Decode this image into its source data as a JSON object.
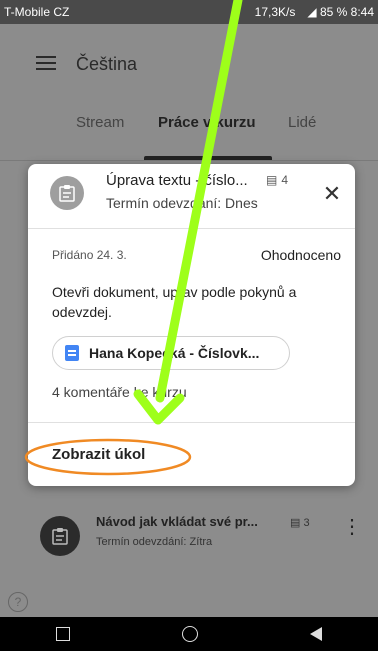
{
  "status_bar": {
    "carrier": "T-Mobile CZ",
    "speed": "17,3K/s",
    "battery": "85 %",
    "time": "8:44"
  },
  "app": {
    "title": "Čeština"
  },
  "tabs": [
    {
      "label": "Stream"
    },
    {
      "label": "Práce v kurzu"
    },
    {
      "label": "Lidé"
    }
  ],
  "background_item": {
    "title": "Návod jak vkládat své pr...",
    "comment_count": "3",
    "due": "Termín odevzdání: Zítra"
  },
  "modal": {
    "title": "Úprava textu - číslo...",
    "comment_count": "4",
    "due": "Termín odevzdání: Dnes",
    "added": "Přidáno 24. 3.",
    "status": "Ohodnoceno",
    "instructions": "Otevři dokument, uprav podle pokynů a odevzdej.",
    "attachment": "Hana Kopecká - Číslovk...",
    "comments_link": "4 komentáře ke kurzu",
    "view_button": "Zobrazit úkol"
  },
  "colors": {
    "annotation_arrow": "#9eff1a",
    "annotation_circle": "#f08a24"
  }
}
